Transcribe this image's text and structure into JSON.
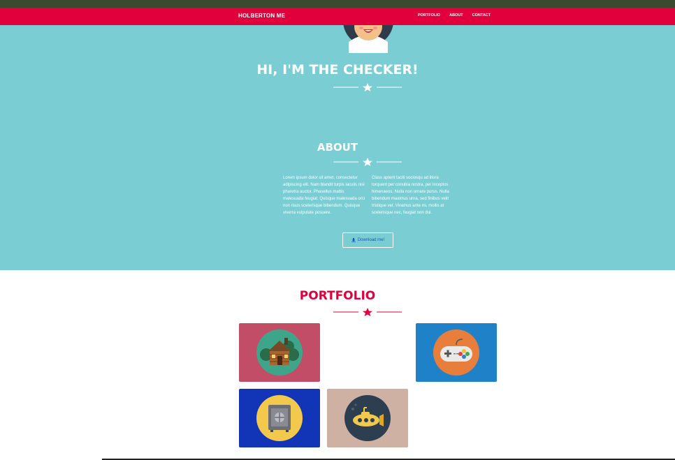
{
  "nav": {
    "brand": "HOLBERTON ME",
    "links": [
      "PORTFOLIO",
      "ABOUT",
      "CONTACT"
    ]
  },
  "hero": {
    "title": "HI, I'M THE CHECKER!"
  },
  "about": {
    "title": "ABOUT",
    "left_text": "Lorem ipsum dolor sit amet, consectetur adipiscing elit. Nam blandit turpis iaculis nisl pharetra auctor. Phasellus mattis malesuada feugiat. Quisque malesuada orci non risus scelerisque bibendum. Quisque viverra vulputate posuere.",
    "right_text": "Class aptent taciti sociosqu ad litora torquent per conubia nostra, per inceptos himenaeos. Nulla non ornare purus. Nulla bibendum maximus urna, sed finibus velit tristique vel. Vivamus ante mi, mollis at scelerisque nec, feugiat non dui.",
    "download_label": "Download me!"
  },
  "portfolio": {
    "title": "PORTFOLIO",
    "items": [
      {
        "icon": "cabin-icon",
        "bg": "#c14e66"
      },
      {
        "icon": "gamepad-icon",
        "bg": "#1f82c8"
      },
      {
        "icon": "safe-icon",
        "bg": "#1235b8"
      },
      {
        "icon": "submarine-icon",
        "bg": "#cfb1a4"
      }
    ]
  },
  "colors": {
    "primary": "#e2003c",
    "hero_bg": "#79cdd3",
    "text_light": "#ffffff"
  }
}
